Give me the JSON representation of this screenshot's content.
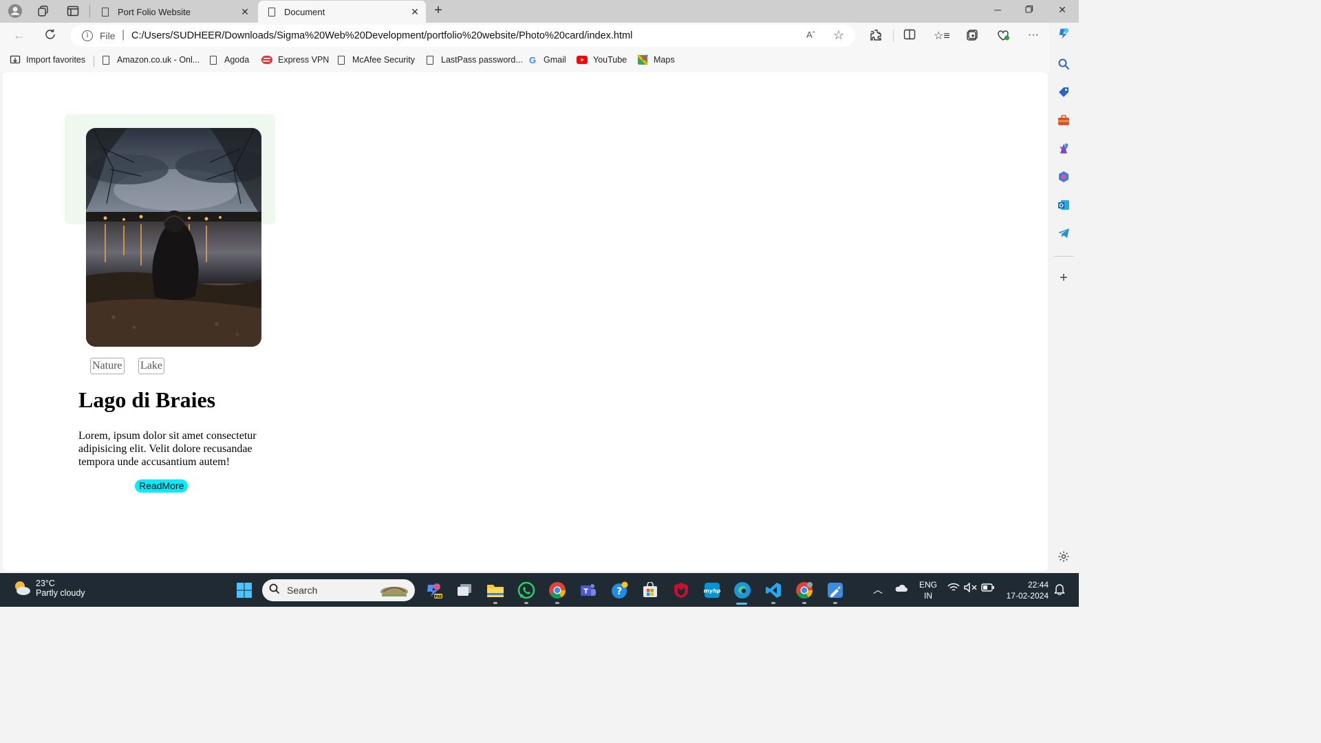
{
  "browser": {
    "tabs": [
      {
        "title": "Port Folio Website",
        "active": false
      },
      {
        "title": "Document",
        "active": true
      }
    ],
    "address": {
      "protocol_label": "File",
      "url": "C:/Users/SUDHEER/Downloads/Sigma%20Web%20Development/portfolio%20website/Photo%20card/index.html",
      "read_aloud_label": "Aˆ"
    },
    "bookmarks": [
      {
        "label": "Import favorites",
        "icon": "import-icon"
      },
      {
        "label": "Amazon.co.uk - Onl...",
        "icon": "page-icon"
      },
      {
        "label": "Agoda",
        "icon": "page-icon"
      },
      {
        "label": "Express VPN",
        "icon": "expressvpn-icon"
      },
      {
        "label": "McAfee Security",
        "icon": "page-icon"
      },
      {
        "label": "LastPass password...",
        "icon": "page-icon"
      },
      {
        "label": "Gmail",
        "icon": "google-icon"
      },
      {
        "label": "YouTube",
        "icon": "youtube-icon"
      },
      {
        "label": "Maps",
        "icon": "maps-icon"
      }
    ]
  },
  "page": {
    "tags": [
      "Nature",
      "Lake"
    ],
    "title": "Lago di Braies",
    "description": "Lorem, ipsum dolor sit amet consectetur adipisicing elit. Velit dolore recusandae tempora unde accusantium autem!",
    "button_label": "ReadMore",
    "colors": {
      "card_bg": "#eef8ee",
      "button_bg": "#00eeff"
    }
  },
  "taskbar": {
    "weather": {
      "temp": "23°C",
      "desc": "Partly cloudy"
    },
    "search_label": "Search",
    "lang": {
      "line1": "ENG",
      "line2": "IN"
    },
    "clock": {
      "time": "22:44",
      "date": "17-02-2024"
    }
  }
}
